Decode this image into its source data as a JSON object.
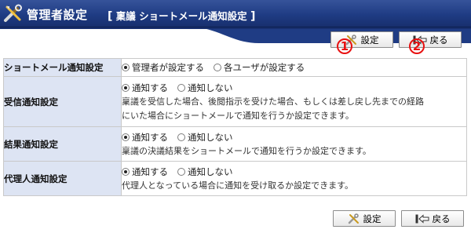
{
  "header": {
    "title": "管理者設定",
    "subtitle_open": "[",
    "subtitle_app": "稟議",
    "subtitle_page": "ショートメール通知設定",
    "subtitle_close": "]"
  },
  "toolbar": {
    "settings_label": "設定",
    "back_label": "戻る",
    "marker_1": "1",
    "marker_2": "2"
  },
  "rows": [
    {
      "label": "ショートメール通知設定",
      "options": [
        {
          "label": "管理者が設定する",
          "checked": true
        },
        {
          "label": "各ユーザが設定する",
          "checked": false
        }
      ],
      "description": ""
    },
    {
      "label": "受信通知設定",
      "options": [
        {
          "label": "通知する",
          "checked": true
        },
        {
          "label": "通知しない",
          "checked": false
        }
      ],
      "description_line1": "稟議を受信した場合、後閲指示を受けた場合、もしくは差し戻し先までの経路",
      "description_line2": "にいた場合にショートメールで通知を行うか設定できます。"
    },
    {
      "label": "結果通知設定",
      "options": [
        {
          "label": "通知する",
          "checked": true
        },
        {
          "label": "通知しない",
          "checked": false
        }
      ],
      "description_line1": "稟議の決議結果をショートメールで通知を行うか設定できます。"
    },
    {
      "label": "代理人通知設定",
      "options": [
        {
          "label": "通知する",
          "checked": true
        },
        {
          "label": "通知しない",
          "checked": false
        }
      ],
      "description_line1": "代理人となっている場合に通知を受け取るか設定できます。"
    }
  ],
  "colors": {
    "title_bar": "#1f3c84",
    "label_cell_bg": "#dde4f3",
    "marker": "#e81010"
  }
}
